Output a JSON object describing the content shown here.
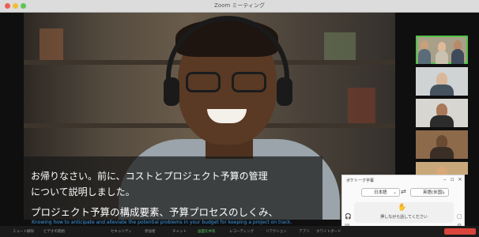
{
  "window": {
    "title": "Zoom ミーティング"
  },
  "subtitles": {
    "line1": "お帰りなさい。前に、コストとプロジェクト予算の管理",
    "line2": "について説明しました。",
    "line3": "プロジェクト予算の構成要素、予算プロセスのしくみ、",
    "english": "Knowing how to anticipate and alleviate the potential problems in your budget for keeping a project on track."
  },
  "pocketalk": {
    "title": "ポケトーク字幕",
    "source_language": "日本語",
    "target_language": "英語(米国)",
    "talk_label": "押しながら話してください"
  },
  "toolbar": {
    "items": [
      "ミュート解除",
      "ビデオの開始",
      "セキュリティ",
      "参加者",
      "チャット",
      "画面を共有",
      "レコーディング",
      "リアクション",
      "アプリ",
      "ホワイトボード"
    ]
  },
  "colors": {
    "accent_green": "#55c04a",
    "end_red": "#d9453b",
    "english_blue": "#3b9ae8"
  }
}
